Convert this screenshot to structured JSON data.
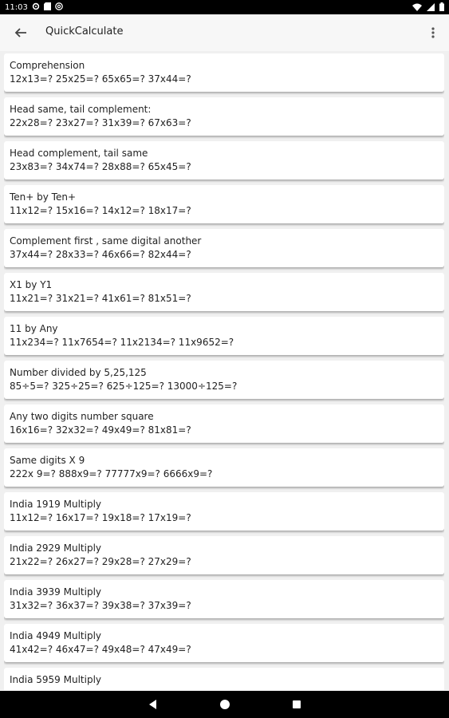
{
  "status_bar": {
    "time": "11:03",
    "left_icons": [
      "gear-icon",
      "sd-card-icon",
      "at-sign-icon"
    ],
    "right_icons": [
      "wifi-icon",
      "signal-icon",
      "battery-icon"
    ]
  },
  "app_bar": {
    "title": "QuickCalculate",
    "back_icon": "arrow-back-icon",
    "menu_icon": "more-vert-icon"
  },
  "items": [
    {
      "title": "Comprehension",
      "examples": "12x13=?  25x25=?  65x65=?  37x44=?"
    },
    {
      "title": "Head same, tail complement:",
      "examples": "22x28=?  23x27=?  31x39=?  67x63=?"
    },
    {
      "title": "Head complement, tail same",
      "examples": "23x83=?  34x74=?  28x88=?  65x45=?"
    },
    {
      "title": "Ten+ by Ten+",
      "examples": "11x12=?  15x16=?  14x12=?  18x17=?"
    },
    {
      "title": "Complement first , same digital another",
      "examples": "37x44=?  28x33=?  46x66=?  82x44=?"
    },
    {
      "title": "X1 by Y1",
      "examples": "11x21=?  31x21=?  41x61=?  81x51=?"
    },
    {
      "title": "11 by Any",
      "examples": "11x234=?  11x7654=?  11x2134=?  11x9652=?"
    },
    {
      "title": "Number divided by 5,25,125",
      "examples": "85÷5=?  325÷25=?  625÷125=?  13000÷125=?"
    },
    {
      "title": "Any two digits number square",
      "examples": "16x16=?  32x32=?  49x49=?  81x81=?"
    },
    {
      "title": "Same digits X 9",
      "examples": "222x 9=?  888x9=?  77777x9=?  6666x9=?"
    },
    {
      "title": "India 1919 Multiply",
      "examples": "11x12=?  16x17=?  19x18=?  17x19=?"
    },
    {
      "title": "India 2929 Multiply",
      "examples": "21x22=?  26x27=?  29x28=?  27x29=?"
    },
    {
      "title": "India 3939 Multiply",
      "examples": "31x32=?  36x37=?  39x38=?  37x39=?"
    },
    {
      "title": "India 4949 Multiply",
      "examples": "41x42=?  46x47=?  49x48=?  47x49=?"
    },
    {
      "title": "India 5959 Multiply",
      "examples": ""
    }
  ],
  "nav_bar": {
    "icons": [
      "back-triangle-icon",
      "home-circle-icon",
      "recents-square-icon"
    ]
  }
}
